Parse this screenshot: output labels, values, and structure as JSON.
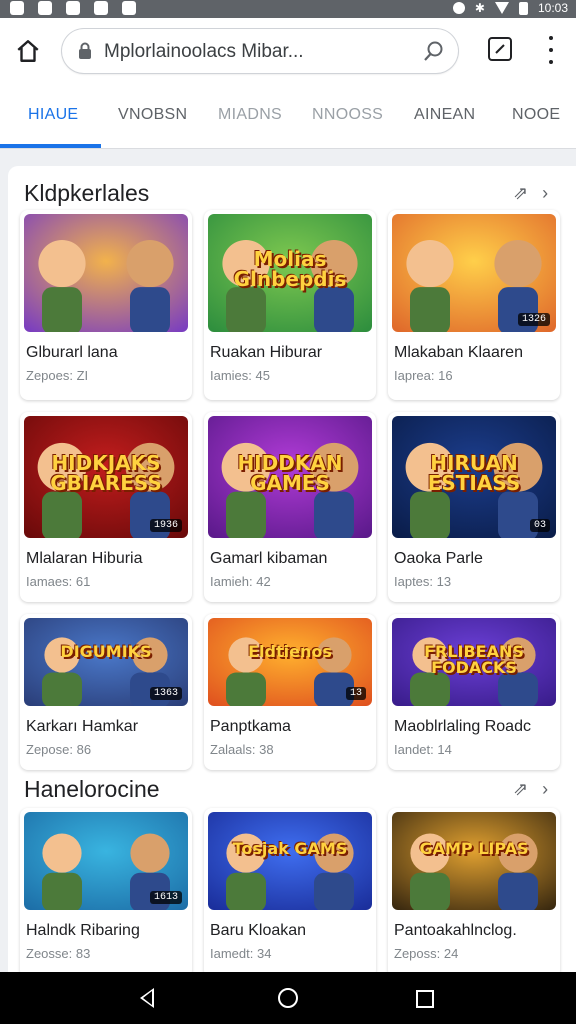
{
  "status_bar": {
    "time": "10:03"
  },
  "browser": {
    "url": "Mplorlainoolacs Mibar...",
    "tabs": [
      {
        "label": "HIAUE",
        "active": true
      },
      {
        "label": "VNOBSN",
        "active": false
      },
      {
        "label": "MIADNS",
        "active": false
      },
      {
        "label": "NNOOSS",
        "active": false
      },
      {
        "label": "AINEAN",
        "active": false
      },
      {
        "label": "NOOE",
        "active": false
      }
    ]
  },
  "sections": [
    {
      "title": "Kldpkerlales",
      "cards": [
        {
          "title": "Glburarl lana",
          "meta": "Zepoes: ZI",
          "badge": "",
          "art": "",
          "palette": [
            "#f2b24c",
            "#7b3fbf"
          ]
        },
        {
          "title": "Ruakan Hiburar",
          "meta": "Iamies: 45",
          "badge": "",
          "art": "Molias Glnbepdis",
          "palette": [
            "#7ec850",
            "#2f8f3e"
          ]
        },
        {
          "title": "Mlakaban Klaaren",
          "meta": "Iaprea: 16",
          "badge": "1326",
          "art": "",
          "palette": [
            "#ffcf4a",
            "#e06a2b"
          ]
        },
        {
          "title": "Mlalaran Hiburia",
          "meta": "Iamaes: 61",
          "badge": "1936",
          "art": "HIDKJAKS GBIARESS",
          "palette": [
            "#c21d1d",
            "#6b0a0a"
          ]
        },
        {
          "title": "Gamarl kibaman",
          "meta": "Iamieh: 42",
          "badge": "",
          "art": "HIDDKAN GAMES",
          "palette": [
            "#b03bd6",
            "#5c1a8c"
          ]
        },
        {
          "title": "Oaoka Parle",
          "meta": "Iaptes: 13",
          "badge": "03",
          "art": "HIRUAN ESTIASS",
          "palette": [
            "#1c3d8c",
            "#0a1d4a"
          ]
        },
        {
          "title": "Karkarı Hamkar",
          "meta": "Zepose: 86",
          "badge": "1363",
          "art": "DIGUMIKS",
          "palette": [
            "#4a78c9",
            "#2b3f7a"
          ]
        },
        {
          "title": "Panptkama",
          "meta": "Zalaals: 38",
          "badge": "13",
          "art": "Eldtienos",
          "palette": [
            "#ffb02e",
            "#e0531f"
          ]
        },
        {
          "title": "Maoblrlaling Roadc",
          "meta": "Iandet: 14",
          "badge": "",
          "art": "FRLIBEANS FODACKS",
          "palette": [
            "#6b3fd6",
            "#3a1d8c"
          ]
        }
      ]
    },
    {
      "title": "Hanelorocine",
      "cards": [
        {
          "title": "Halndk Ribaring",
          "meta": "Zeosse: 83",
          "badge": "1613",
          "art": "",
          "palette": [
            "#39b4e0",
            "#1d6fa8"
          ]
        },
        {
          "title": "Baru Kloakan",
          "meta": "Iamedt: 34",
          "badge": "",
          "art": "Tosjak GAMS",
          "palette": [
            "#3f6ef0",
            "#1b2f9c"
          ]
        },
        {
          "title": "Pantoakahlnclog.",
          "meta": "Zeposs: 24",
          "badge": "",
          "art": "GAMP LIPAS",
          "palette": [
            "#e0a030",
            "#3b2a10"
          ]
        }
      ]
    }
  ]
}
